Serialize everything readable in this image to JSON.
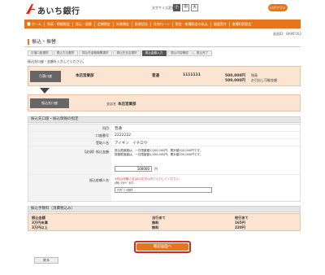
{
  "header": {
    "bank_name": "あいち銀行",
    "font_size_label": "文字サイズ変更",
    "font_sizes": [
      "小",
      "中",
      "大"
    ],
    "logout_label": "ログアウト"
  },
  "nav": {
    "items": [
      "ホーム",
      "残高・明細照会",
      "振込・振替",
      "定期預金",
      "外貨預金",
      "投資信託",
      "住宅ローン",
      "税金・各種料金の払込",
      "諸届受付",
      "各種利用設定"
    ]
  },
  "screen_id": "画面ID：BKMF002",
  "page_title": "振込・振替",
  "steps": [
    "引落口座選択",
    "振込方法選択",
    "振込先金融機関選択",
    "振込先支店選択",
    "振込金額入力",
    "振込内容確認",
    "振込完了"
  ],
  "instruction": "振込先口座・金額を入力してください。",
  "from_account": {
    "label": "引落口座",
    "branch": "本店営業部",
    "type": "普通",
    "number": "1111111",
    "balance": "500,000円",
    "balance_label": "残高",
    "available": "500,000円",
    "available_label": "お引出し可能金額"
  },
  "to_account": {
    "label": "振込先口座",
    "branch_label": "支店名",
    "branch": "本店営業部"
  },
  "form_section": {
    "title": "振込先口座・振込情報の指定",
    "subject_label": "科目",
    "subject": "普通",
    "account_label": "口座番号",
    "account": "2222222",
    "recipient_label": "受取人名",
    "recipient": "アイギン　イチロウ",
    "amount_required": "【必須】",
    "amount_label": "振込金額",
    "amount_note1": "振込限度額は、一日限度額1,000,000円、累計額100,000円です。",
    "amount_note2": "振替限度額は、一日限度額1,000,000円、累計額100,000円です。",
    "amount_value": "100000",
    "amount_unit": "円",
    "requester_label": "振込依頼人名",
    "requester_note1": "※振込依頼人名は20文字以内で入力してください。",
    "requester_note2": "(例) ﾜﾀﾅﾍﾞ ﾀﾛｳ",
    "requester_value": "ｱｲｷﾞﾝ ｲﾁﾛｳ"
  },
  "fee_section": {
    "title": "振込手数料（消費税込み）",
    "headers": [
      "振込金額",
      "当行あて",
      "他行あて"
    ],
    "rows": [
      {
        "range": "3万円未満",
        "own": "無料",
        "other": "165円"
      },
      {
        "range": "3万円以上",
        "own": "無料",
        "other": "220円"
      }
    ]
  },
  "buttons": {
    "confirm": "確認画面へ",
    "back": "戻る"
  },
  "colors": {
    "brand_orange": "#e8751a",
    "highlight_red": "#d8291a",
    "peach": "#fbe4d2"
  }
}
